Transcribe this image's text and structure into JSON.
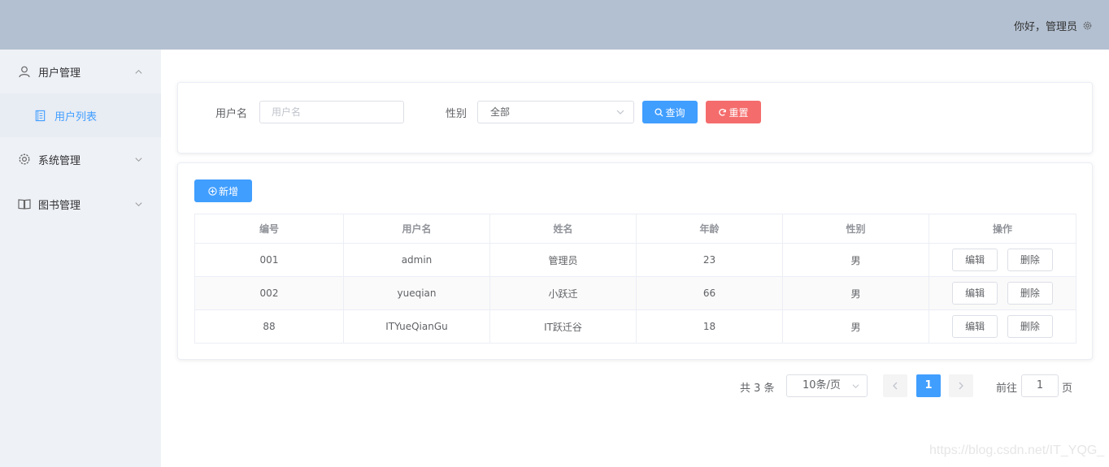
{
  "header": {
    "greeting": "你好，管理员",
    "icon": "gear-icon"
  },
  "sidebar": {
    "items": [
      {
        "label": "用户管理",
        "icon": "user-icon",
        "expanded": true,
        "children": [
          {
            "label": "用户列表",
            "icon": "document-list-icon",
            "active": true
          }
        ]
      },
      {
        "label": "系统管理",
        "icon": "gear-icon",
        "expanded": false
      },
      {
        "label": "图书管理",
        "icon": "book-icon",
        "expanded": false
      }
    ]
  },
  "search": {
    "username_label": "用户名",
    "username_placeholder": "用户名",
    "gender_label": "性别",
    "gender_value": "全部",
    "query_label": "查询",
    "reset_label": "重置"
  },
  "table": {
    "add_label": "新增",
    "columns": [
      "编号",
      "用户名",
      "姓名",
      "年龄",
      "性别",
      "操作"
    ],
    "rows": [
      {
        "id": "001",
        "username": "admin",
        "name": "管理员",
        "age": "23",
        "gender": "男"
      },
      {
        "id": "002",
        "username": "yueqian",
        "name": "小跃迁",
        "age": "66",
        "gender": "男"
      },
      {
        "id": "88",
        "username": "ITYueQianGu",
        "name": "IT跃迁谷",
        "age": "18",
        "gender": "男"
      }
    ],
    "edit_label": "编辑",
    "delete_label": "删除"
  },
  "pagination": {
    "total_text": "共 3 条",
    "page_size": "10条/页",
    "current_page": "1",
    "goto_label": "前往",
    "goto_value": "1",
    "page_unit": "页"
  },
  "watermark": "https://blog.csdn.net/IT_YQG_",
  "colors": {
    "header_bg": "#b3c0d1",
    "sidebar_bg": "#eef1f6",
    "primary": "#409eff",
    "danger": "#f56c6c"
  }
}
